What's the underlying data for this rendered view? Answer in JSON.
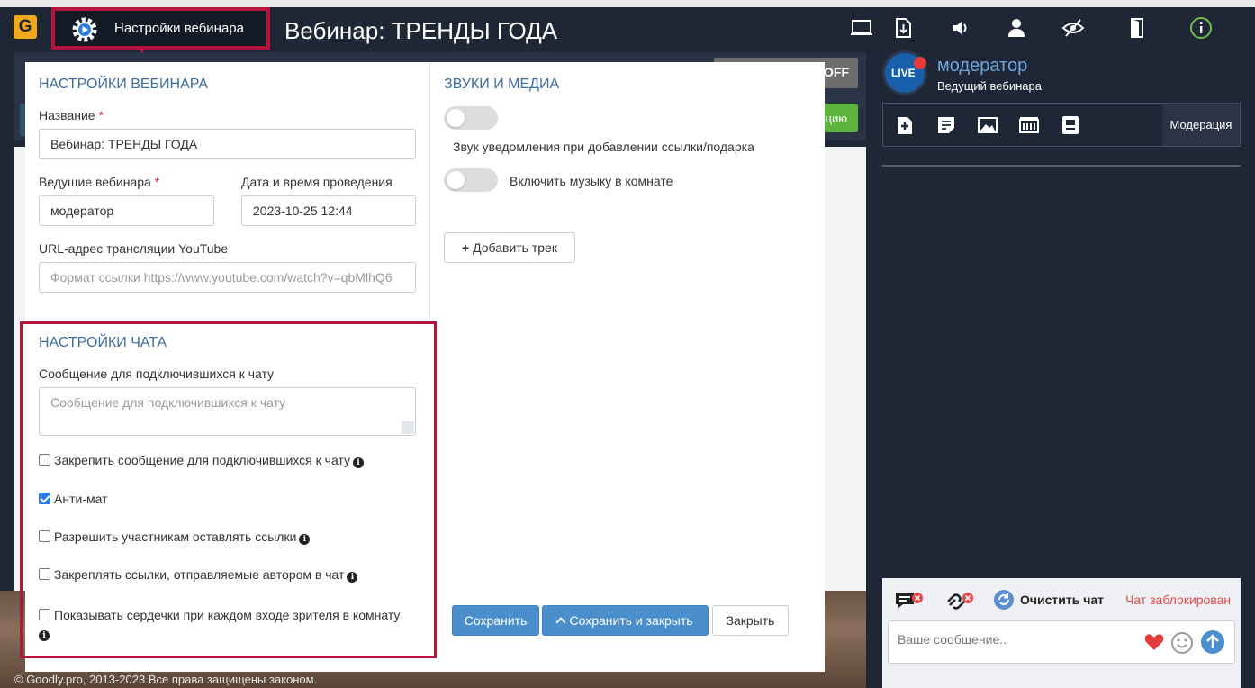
{
  "topbar": {
    "logo_text": "G",
    "settings_label": "Настройки вебинара",
    "title": "Вебинар: ТРЕНДЫ ГОДА",
    "icons": [
      "screen-icon",
      "download-icon",
      "sound-icon",
      "user-icon",
      "no-eye-icon",
      "exit-door-icon",
      "info-icon"
    ]
  },
  "stage": {
    "off_label": "OFF",
    "green_label": "цию",
    "footer": "© Goodly.pro, 2013-2023 Все права защищены законом."
  },
  "moderator_panel": {
    "avatar_text": "LIVE",
    "name": "модератор",
    "role": "Ведущий вебинара",
    "moderation_tab": "Модерация"
  },
  "chat": {
    "clear_label": "Очистить чат",
    "locked_label": "Чат заблокирован",
    "placeholder": "Ваше сообщение.."
  },
  "modal": {
    "webinar_section": "НАСТРОЙКИ ВЕБИНАРА",
    "name_label": "Название",
    "name_value": "Вебинар: ТРЕНДЫ ГОДА",
    "hosts_label": "Ведущие вебинара",
    "hosts_value": "модератор",
    "datetime_label": "Дата и время проведения",
    "datetime_value": "2023-10-25 12:44",
    "youtube_label": "URL-адрес трансляции YouTube",
    "youtube_placeholder": "Формат ссылки https://www.youtube.com/watch?v=qbMlhQ6",
    "media_section": "ЗВУКИ И МЕДИА",
    "notify_sound_label": "Звук уведомления при добавлении ссылки/подарка",
    "music_label": "Включить музыку в комнате",
    "add_track": "Добавить трек",
    "chat_section": "НАСТРОЙКИ ЧАТА",
    "welcome_label": "Сообщение для подключившихся к чату",
    "welcome_placeholder": "Сообщение для подключившихся к чату",
    "options": [
      {
        "label": "Закрепить сообщение для подключившихся к чату",
        "checked": false
      },
      {
        "label": "Анти-мат",
        "checked": true
      },
      {
        "label": "Разрешить участникам оставлять ссылки",
        "checked": false
      },
      {
        "label": "Закреплять ссылки, отправляемые автором в чат",
        "checked": false
      },
      {
        "label": "Показывать сердечки при каждом входе зрителя в комнату",
        "checked": false
      }
    ],
    "save": "Сохранить",
    "save_close": "Сохранить и закрыть",
    "close": "Закрыть"
  },
  "colors": {
    "accent_red": "#b5153a",
    "primary_blue": "#4a8fcb",
    "section_blue": "#3b6d9e",
    "dark_bg": "#1f2635"
  }
}
